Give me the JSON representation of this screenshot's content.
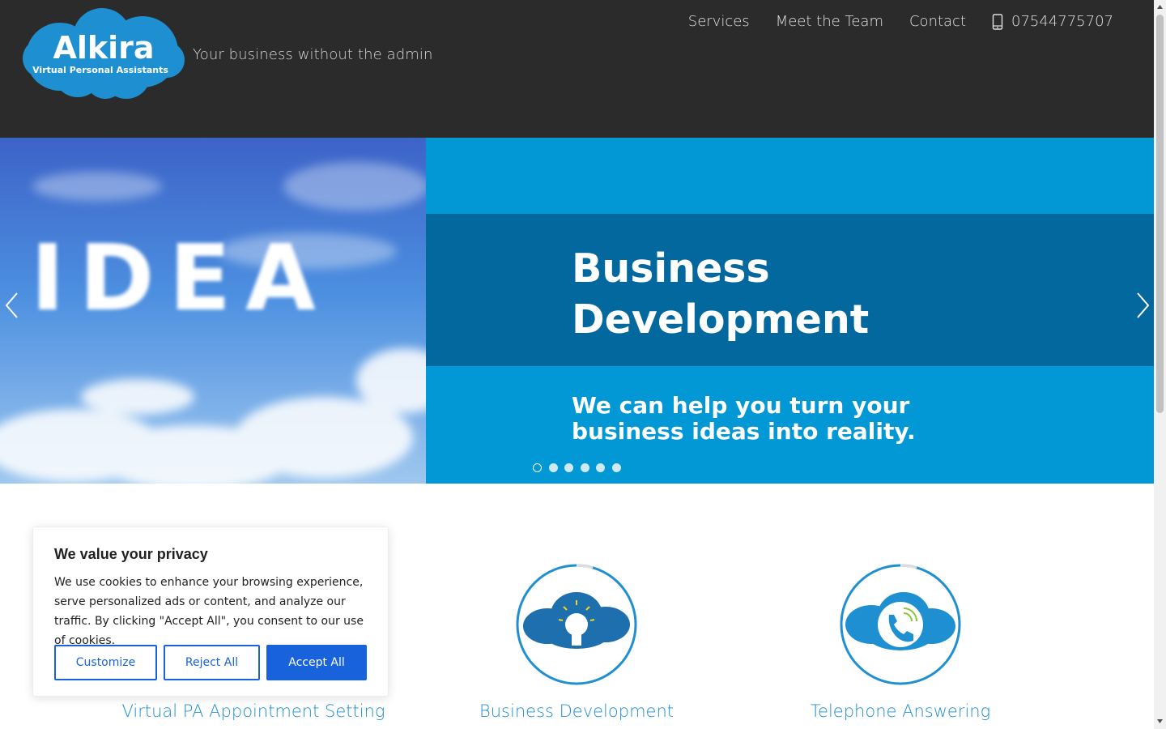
{
  "header": {
    "logo_text": "Alkira",
    "logo_subtext": "Virtual Personal Assistants",
    "tagline": "Your business without the admin",
    "nav": [
      {
        "label": "Services"
      },
      {
        "label": "Meet the Team"
      },
      {
        "label": "Contact"
      }
    ],
    "phone": "07544775707",
    "phone_icon": "mobile-phone-icon"
  },
  "hero": {
    "sky_word": "IDEA",
    "title": "Business Development",
    "subtitle": "We can help you turn your business ideas into reality.",
    "slide_count": 6,
    "active_slide": 1,
    "colors": {
      "light_blue": "#0298d6",
      "dark_blue": "#03689e"
    }
  },
  "services": [
    {
      "label": "Virtual PA Appointment Setting",
      "icon": "calendar-cloud-icon"
    },
    {
      "label": "Business Development",
      "icon": "lightbulb-cloud-icon"
    },
    {
      "label": "Telephone Answering",
      "icon": "phone-cloud-icon"
    }
  ],
  "cookie": {
    "title": "We value your privacy",
    "text": "We use cookies to enhance your browsing experience, serve personalized ads or content, and analyze our traffic. By clicking \"Accept All\", you consent to our use of cookies.",
    "customize": "Customize",
    "reject": "Reject All",
    "accept": "Accept All",
    "accent": "#1863dc"
  }
}
